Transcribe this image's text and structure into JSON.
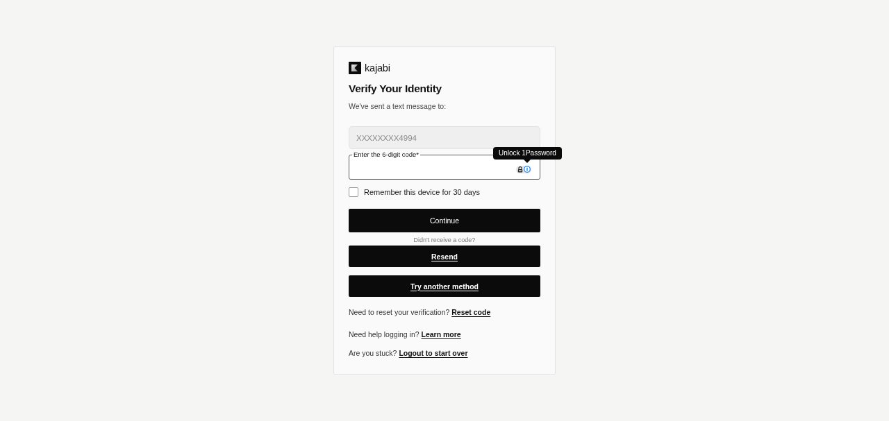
{
  "logo": {
    "name": "kajabi"
  },
  "title": "Verify Your Identity",
  "subtitle": "We've sent a text message to:",
  "phone_field": {
    "value": "XXXXXXXX4994",
    "disabled": true
  },
  "code_field": {
    "label": "Enter the 6-digit code*",
    "tooltip": "Unlock 1Password"
  },
  "remember_checkbox": {
    "label": "Remember this device for 30 days",
    "checked": false
  },
  "continue_button": {
    "label": "Continue"
  },
  "resend_prompt": "Didn't receive a code?",
  "alt_buttons": [
    {
      "label": "Resend"
    },
    {
      "label": "Try another method"
    }
  ],
  "help_lines": [
    {
      "text": "Need to reset your verification?",
      "link": "Reset code"
    },
    {
      "text": "Need help logging in?",
      "link": "Learn more"
    },
    {
      "text": "Are you stuck?",
      "link": "Logout to start over"
    }
  ]
}
